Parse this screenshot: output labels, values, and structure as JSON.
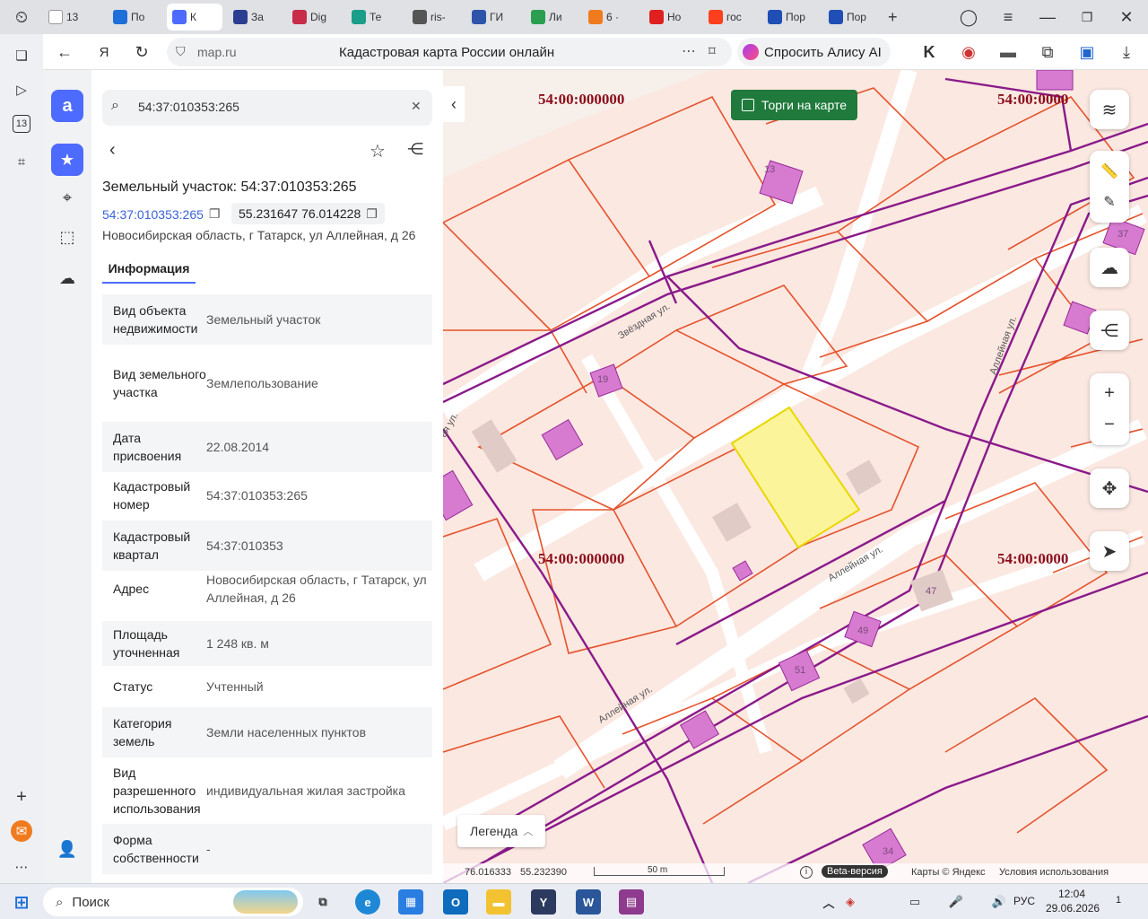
{
  "browser": {
    "tabs": [
      {
        "label": "13",
        "color": "#ffffff",
        "active": false
      },
      {
        "label": "По",
        "color": "#1e6fd9"
      },
      {
        "label": "К",
        "color": "#4d6bfe",
        "active": true
      },
      {
        "label": "За",
        "color": "#2c3e91"
      },
      {
        "label": "Dig",
        "color": "#c72c48"
      },
      {
        "label": "Те",
        "color": "#1a9e8a"
      },
      {
        "label": "ris-",
        "color": "#555555"
      },
      {
        "label": "ГИ",
        "color": "#2d54a8"
      },
      {
        "label": "Ли",
        "color": "#2b9e4f"
      },
      {
        "label": "6 ·",
        "color": "#f07b1e"
      },
      {
        "label": "Но",
        "color": "#e02020"
      },
      {
        "label": "гос",
        "color": "#fc3f1d"
      },
      {
        "label": "Пор",
        "color": "#1f4fb4"
      },
      {
        "label": "Пор",
        "color": "#1f4fb4"
      }
    ],
    "new_tab": "+",
    "url": "map.ru",
    "page_title": "Кадастровая карта России онлайн",
    "alice_button": "Спросить Алису AI"
  },
  "panel": {
    "search_value": "54:37:010353:265",
    "title": "Земельный участок: 54:37:010353:265",
    "cadastral_link": "54:37:010353:265",
    "coords_chip": "55.231647 76.014228",
    "address": "Новосибирская область, г Татарск, ул Аллейная, д 26",
    "tab_info": "Информация",
    "rows": [
      {
        "label": "Вид объекта недвижимости",
        "value": "Земельный участок"
      },
      {
        "label": "Вид земельного участка",
        "value": "Землепользование"
      },
      {
        "label": "Дата присвоения",
        "value": "22.08.2014"
      },
      {
        "label": "Кадастровый номер",
        "value": "54:37:010353:265"
      },
      {
        "label": "Кадастровый квартал",
        "value": "54:37:010353"
      },
      {
        "label": "Адрес",
        "value": "Новосибирская область, г Татарск, ул Аллейная, д 26"
      },
      {
        "label": "Площадь уточненная",
        "value": "1 248 кв. м"
      },
      {
        "label": "Статус",
        "value": "Учтенный"
      },
      {
        "label": "Категория земель",
        "value": "Земли населенных пунктов"
      },
      {
        "label": "Вид разрешенного использования",
        "value": "индивидуальная жилая застройка"
      },
      {
        "label": "Форма собственности",
        "value": "-"
      }
    ]
  },
  "map": {
    "torgi_label": "Торги на карте",
    "legend_label": "Легенда",
    "district_labels": [
      "54:00:000000",
      "54:00:0000",
      "54:00:000000",
      "54:00:0000"
    ],
    "street_labels": [
      "Звёздная ул.",
      "Аллейная ул.",
      "Аллейная ул.",
      "Аллейная ул.",
      "ая ул."
    ],
    "house_numbers": [
      "13",
      "19",
      "37",
      "47",
      "49",
      "51",
      "34"
    ],
    "coord_lon": "76.016333",
    "coord_lat": "55.232390",
    "scale_label": "50 m",
    "info_icon": "i",
    "beta_label": "Beta-версия",
    "copyright": "Карты © Яндекс",
    "terms": "Условия использования"
  },
  "taskbar": {
    "search_label": "Поиск",
    "language": "РУС",
    "time": "12:04",
    "date": "29.06.2026",
    "notification_count": "1"
  },
  "colors": {
    "accent": "#4d6bfe",
    "torgi_green": "#1f7a3c",
    "parcel_yellow": "#fcf49a",
    "road_purple": "#8a1a8a",
    "boundary_red": "#e5532c",
    "district_label": "#8b0d1b"
  }
}
